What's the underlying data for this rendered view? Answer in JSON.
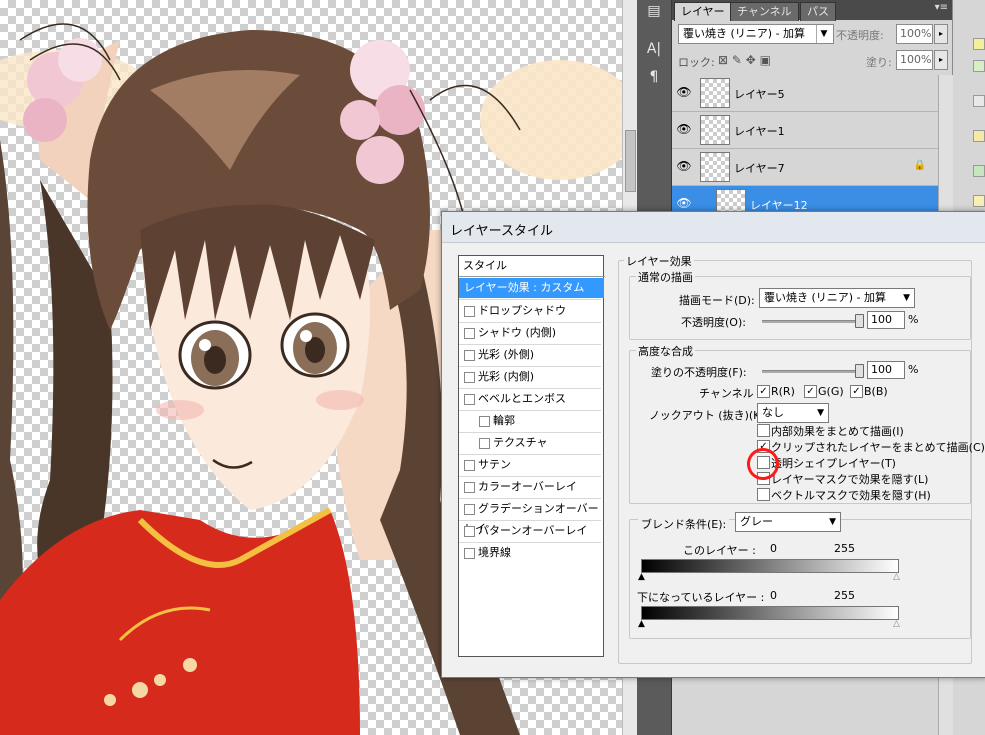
{
  "layers_panel": {
    "tabs": [
      "レイヤー",
      "チャンネル",
      "パス"
    ],
    "blend_mode": "覆い焼き (リニア) - 加算",
    "opacity_label": "不透明度:",
    "opacity_value": "100%",
    "lock_label": "ロック:",
    "fill_label": "塗り:",
    "fill_value": "100%",
    "layers": [
      {
        "name": "レイヤー5",
        "locked": false,
        "selected": false
      },
      {
        "name": "レイヤー1",
        "locked": false,
        "selected": false
      },
      {
        "name": "レイヤー7",
        "locked": true,
        "selected": false
      },
      {
        "name": "レイヤー12",
        "locked": false,
        "selected": true
      }
    ]
  },
  "dialog": {
    "title": "レイヤースタイル",
    "styles_header": "スタイル",
    "style_items": [
      {
        "label": "レイヤー効果 : カスタム",
        "checkbox": false,
        "active": true,
        "indent": false
      },
      {
        "label": "ドロップシャドウ",
        "checkbox": true,
        "active": false,
        "indent": false
      },
      {
        "label": "シャドウ (内側)",
        "checkbox": true,
        "active": false,
        "indent": false
      },
      {
        "label": "光彩 (外側)",
        "checkbox": true,
        "active": false,
        "indent": false
      },
      {
        "label": "光彩 (内側)",
        "checkbox": true,
        "active": false,
        "indent": false
      },
      {
        "label": "ベベルとエンボス",
        "checkbox": true,
        "active": false,
        "indent": false
      },
      {
        "label": "輪郭",
        "checkbox": true,
        "active": false,
        "indent": true
      },
      {
        "label": "テクスチャ",
        "checkbox": true,
        "active": false,
        "indent": true
      },
      {
        "label": "サテン",
        "checkbox": true,
        "active": false,
        "indent": false
      },
      {
        "label": "カラーオーバーレイ",
        "checkbox": true,
        "active": false,
        "indent": false
      },
      {
        "label": "グラデーションオーバーレイ",
        "checkbox": true,
        "active": false,
        "indent": false
      },
      {
        "label": "パターンオーバーレイ",
        "checkbox": true,
        "active": false,
        "indent": false
      },
      {
        "label": "境界線",
        "checkbox": true,
        "active": false,
        "indent": false
      }
    ],
    "effects_title": "レイヤー効果",
    "general_title": "通常の描画",
    "blend_mode_label": "描画モード(D):",
    "blend_mode_value": "覆い焼き (リニア) - 加算",
    "opacity_label": "不透明度(O):",
    "opacity_value": "100",
    "percent": "%",
    "advanced_title": "高度な合成",
    "fill_opacity_label": "塗りの不透明度(F):",
    "fill_opacity_value": "100",
    "channels_label": "チャンネル :",
    "channel_r": "R(R)",
    "channel_g": "G(G)",
    "channel_b": "B(B)",
    "knockout_label": "ノックアウト (抜き)(K):",
    "knockout_value": "なし",
    "opt_interior": "内部効果をまとめて描画(I)",
    "opt_clipped": "クリップされたレイヤーをまとめて描画(C)",
    "opt_transparency": "透明シェイプレイヤー(T)",
    "opt_layer_mask": "レイヤーマスクで効果を隠す(L)",
    "opt_vector_mask": "ベクトルマスクで効果を隠す(H)",
    "blend_if_label": "ブレンド条件(E):",
    "blend_if_value": "グレー",
    "this_layer_label": "このレイヤー :",
    "this_layer_min": "0",
    "this_layer_max": "255",
    "underlying_label": "下になっているレイヤー :",
    "underlying_min": "0",
    "underlying_max": "255"
  },
  "colors": {
    "selection_blue": "#3399ff",
    "annotation_red": "#ff1a1a"
  }
}
